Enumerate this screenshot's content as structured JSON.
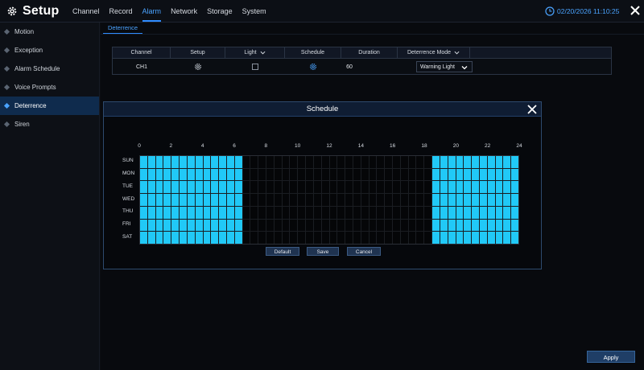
{
  "header": {
    "title": "Setup",
    "menu": [
      "Channel",
      "Record",
      "Alarm",
      "Network",
      "Storage",
      "System"
    ],
    "active_menu_index": 2,
    "datetime": "02/20/2026 11:10:25"
  },
  "sidebar": {
    "items": [
      {
        "label": "Motion"
      },
      {
        "label": "Exception"
      },
      {
        "label": "Alarm Schedule"
      },
      {
        "label": "Voice Prompts"
      },
      {
        "label": "Deterrence"
      },
      {
        "label": "Siren"
      }
    ],
    "active_index": 4
  },
  "subtab": {
    "label": "Deterrence"
  },
  "table": {
    "headers": [
      "Channel",
      "Setup",
      "Light",
      "Schedule",
      "Duration",
      "Deterrence Mode"
    ],
    "row": {
      "channel": "CH1",
      "light_checked": false,
      "duration": "60",
      "mode": "Warning Light"
    }
  },
  "modal": {
    "title": "Schedule",
    "hour_labels": [
      "0",
      "2",
      "4",
      "6",
      "8",
      "10",
      "12",
      "14",
      "16",
      "18",
      "20",
      "22",
      "24"
    ],
    "days": [
      "SUN",
      "MON",
      "TUE",
      "WED",
      "THU",
      "FRI",
      "SAT"
    ],
    "scheduled_hours": [
      [
        0,
        6.5
      ],
      [
        18.5,
        24
      ]
    ],
    "active_color": "#21c9f7",
    "buttons": {
      "default": "Default",
      "save": "Save",
      "cancel": "Cancel"
    }
  },
  "footer": {
    "apply": "Apply"
  }
}
